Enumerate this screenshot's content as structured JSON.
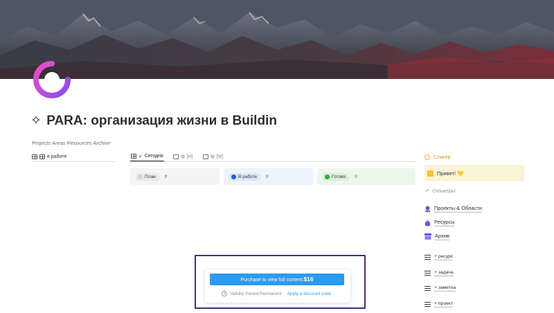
{
  "page": {
    "title": "PARA: организация жизни в Buildin",
    "title_icon": "sparkle",
    "subtitle": "Projects Areas Resources Archive"
  },
  "left_panel": {
    "tab_label": "в работе"
  },
  "views": {
    "tabs": [
      {
        "label": "Сегодня",
        "icon": "check-icon",
        "active": true
      },
      {
        "label": "[Н]",
        "icon": "calendar-icon",
        "active": false
      },
      {
        "label": "[М]",
        "icon": "calendar-icon",
        "active": false
      }
    ]
  },
  "boards": [
    {
      "label": "План",
      "count": "0",
      "color": "#dcdcdc",
      "bg": "#f4f4f4"
    },
    {
      "label": "В работе",
      "count": "0",
      "color": "#2a5bd7",
      "bg": "#eef3fb"
    },
    {
      "label": "Готово",
      "count": "0",
      "color": "#2fae3a",
      "bg": "#eef6ee"
    }
  ],
  "purchase": {
    "button_label": "Purchase to view full content:",
    "price": "$16",
    "validity": "Validity Period:Permanent",
    "discount_link": "Apply a discount code"
  },
  "sidebar": {
    "sticker_heading": "Стикер",
    "hello_card": "Привет! 💛",
    "stickers_link": "Стикеры",
    "sections": [
      {
        "label": "Проекты & Области",
        "icon": "pin-icon"
      },
      {
        "label": "Ресурсы",
        "icon": "bag-icon"
      },
      {
        "label": "Архив",
        "icon": "archive-icon"
      }
    ],
    "quick_add": [
      "+ ресурс",
      "+ задача",
      "+ заметка",
      "+ проект"
    ]
  },
  "colors": {
    "accent_blue": "#2d9bef",
    "frame_purple": "#4b2a75",
    "logo_pink": "#e542b8",
    "logo_purple": "#7a4cf2"
  }
}
